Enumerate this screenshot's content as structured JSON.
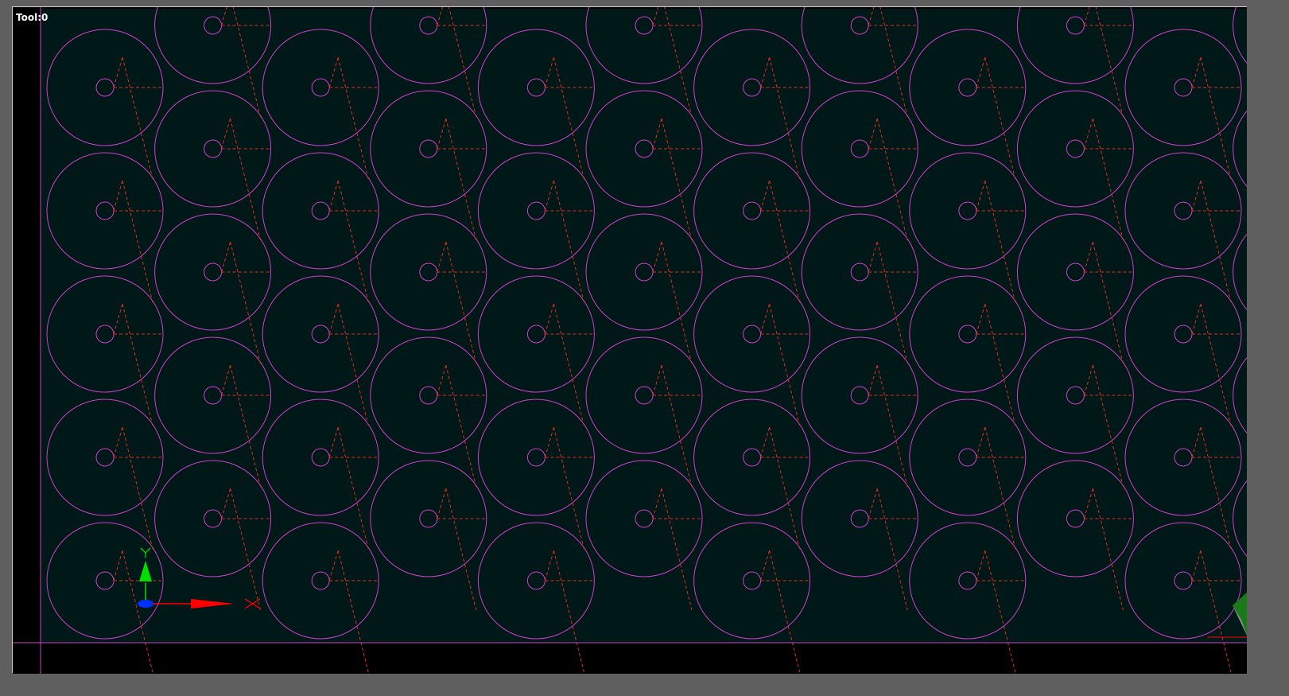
{
  "viewport": {
    "tool_label": "Tool:0",
    "background_color": "#001818",
    "margin_color": "#000000",
    "circle_color": "#d040c8",
    "toolpath_color": "#e03020",
    "boundary_color": "#d040c8"
  },
  "axis_gizmo": {
    "x_label": "X",
    "y_label": "Y",
    "x_color": "#ff0000",
    "y_color": "#00e000",
    "origin_color": "#0030ff"
  }
}
